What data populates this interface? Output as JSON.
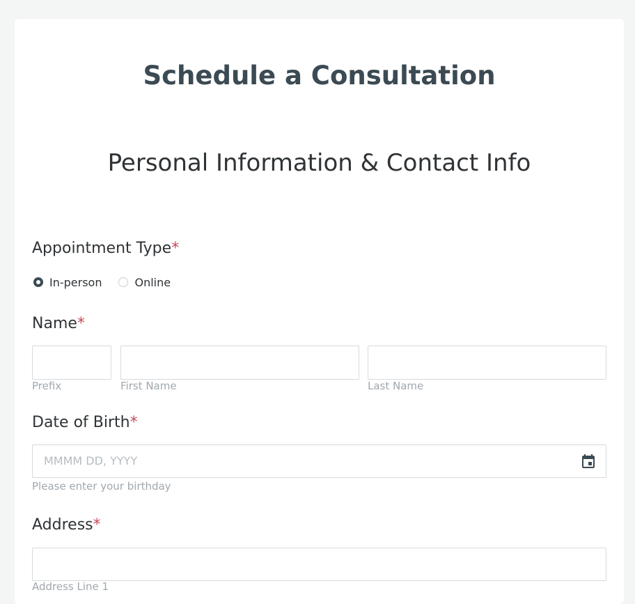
{
  "form": {
    "title": "Schedule a Consultation",
    "subtitle": "Personal Information & Contact Info"
  },
  "appointment_type": {
    "label": "Appointment Type",
    "required_mark": "*",
    "options": [
      {
        "label": "In-person",
        "selected": true
      },
      {
        "label": "Online",
        "selected": false
      }
    ]
  },
  "name": {
    "label": "Name",
    "required_mark": "*",
    "prefix_label": "Prefix",
    "first_name_label": "First Name",
    "last_name_label": "Last Name"
  },
  "date_of_birth": {
    "label": "Date of Birth",
    "required_mark": "*",
    "placeholder": "MMMM DD, YYYY",
    "helper": "Please enter your birthday",
    "icon": "calendar-icon"
  },
  "address": {
    "label": "Address",
    "required_mark": "*",
    "line1_label": "Address Line 1"
  },
  "colors": {
    "title": "#3b4a53",
    "required": "#c64a5a",
    "background": "#f4f6f5"
  }
}
